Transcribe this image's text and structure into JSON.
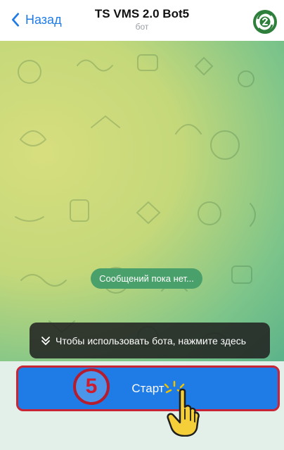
{
  "header": {
    "back_label": "Назад",
    "title": "TS VMS 2.0 Bot5",
    "subtitle": "бот"
  },
  "chat": {
    "empty_message": "Сообщений пока нет...",
    "hint_text": "Чтобы использовать бота, нажмите здесь"
  },
  "bottom": {
    "start_button_label": "Старт",
    "step_number": "5"
  },
  "icons": {
    "back": "chevron-left-icon",
    "avatar": "bot-avatar-icon",
    "hint": "double-chevron-down-icon",
    "hand": "pointing-hand-icon"
  },
  "colors": {
    "accent_blue": "#1f7be6",
    "step_red": "#c82537",
    "bubble_green": "#49a06a"
  }
}
